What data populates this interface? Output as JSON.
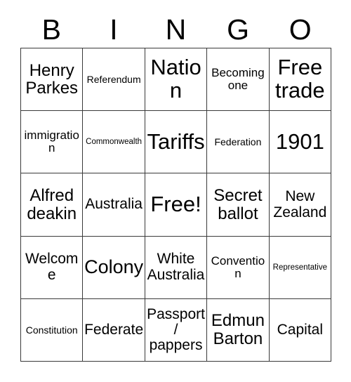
{
  "header": {
    "letters": [
      "B",
      "I",
      "N",
      "G",
      "O"
    ]
  },
  "grid": {
    "columns": 5,
    "rows": 5,
    "border_color": "#3a3a3a",
    "background_color": "#ffffff",
    "text_color": "#000000",
    "cells": [
      [
        {
          "text": "Henry Parkes",
          "size": "lg"
        },
        {
          "text": "Referendum",
          "size": "xs"
        },
        {
          "text": "Nation",
          "size": "xxl"
        },
        {
          "text": "Becoming one",
          "size": "sm"
        },
        {
          "text": "Free trade",
          "size": "xxl"
        }
      ],
      [
        {
          "text": "immigration",
          "size": "sm"
        },
        {
          "text": "Commonwealth",
          "size": "xxs"
        },
        {
          "text": "Tariffs",
          "size": "xxl"
        },
        {
          "text": "Federation",
          "size": "xs"
        },
        {
          "text": "1901",
          "size": "xxl"
        }
      ],
      [
        {
          "text": "Alfred deakin",
          "size": "lg"
        },
        {
          "text": "Australia",
          "size": "md"
        },
        {
          "text": "Free!",
          "size": "xxl"
        },
        {
          "text": "Secret ballot",
          "size": "lg"
        },
        {
          "text": "New Zealand",
          "size": "md"
        }
      ],
      [
        {
          "text": "Welcome",
          "size": "md"
        },
        {
          "text": "Colony",
          "size": "xl"
        },
        {
          "text": "White Australia",
          "size": "md"
        },
        {
          "text": "Convention",
          "size": "sm"
        },
        {
          "text": "Representative",
          "size": "xxs"
        }
      ],
      [
        {
          "text": "Constitution",
          "size": "xs"
        },
        {
          "text": "Federate",
          "size": "md"
        },
        {
          "text": "Passport/ pappers",
          "size": "md"
        },
        {
          "text": "Edmun Barton",
          "size": "lg"
        },
        {
          "text": "Capital",
          "size": "md"
        }
      ]
    ]
  }
}
